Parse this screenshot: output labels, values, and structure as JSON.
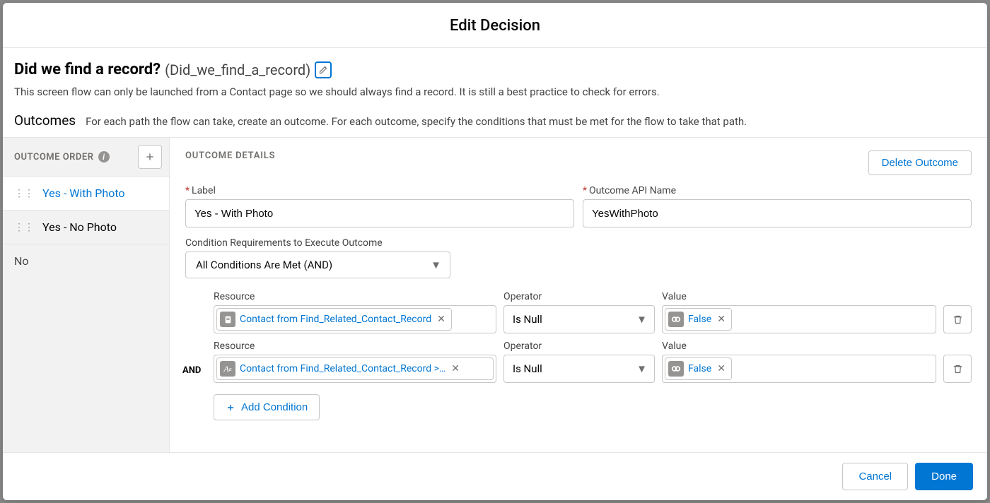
{
  "modal": {
    "title": "Edit Decision"
  },
  "decision": {
    "label": "Did we find a record?",
    "api_name": "(Did_we_find_a_record)",
    "description": "This screen flow can only be launched from a Contact page so we should always find a record. It is still a best practice to check for errors."
  },
  "outcomes_section": {
    "label": "Outcomes",
    "help": "For each path the flow can take, create an outcome. For each outcome, specify the conditions that must be met for the flow to take that path."
  },
  "sidebar": {
    "header": "OUTCOME ORDER",
    "items": [
      {
        "label": "Yes - With Photo",
        "selected": true
      },
      {
        "label": "Yes - No Photo",
        "selected": false
      }
    ],
    "default_label": "No"
  },
  "details": {
    "header": "OUTCOME DETAILS",
    "delete_label": "Delete Outcome",
    "label_field": {
      "label": "Label",
      "value": "Yes - With Photo"
    },
    "api_field": {
      "label": "Outcome API Name",
      "value": "YesWithPhoto"
    },
    "cond_req": {
      "label": "Condition Requirements to Execute Outcome",
      "value": "All Conditions Are Met (AND)"
    },
    "cond_labels": {
      "resource": "Resource",
      "operator": "Operator",
      "value": "Value"
    },
    "conditions": [
      {
        "and_prefix": "",
        "resource": {
          "icon": "record",
          "text": "Contact from Find_Related_Contact_Record"
        },
        "operator": "Is Null",
        "value": {
          "icon": "bool",
          "text": "False"
        }
      },
      {
        "and_prefix": "AND",
        "resource": {
          "icon": "text",
          "text": "Contact from Find_Related_Contact_Record >…"
        },
        "operator": "Is Null",
        "value": {
          "icon": "bool",
          "text": "False"
        }
      }
    ],
    "add_condition_label": "Add Condition"
  },
  "footer": {
    "cancel": "Cancel",
    "done": "Done"
  }
}
